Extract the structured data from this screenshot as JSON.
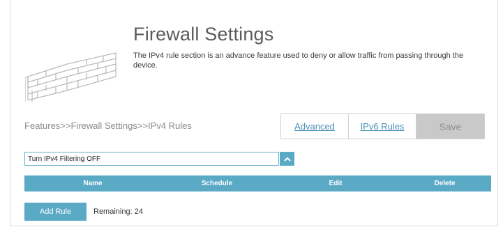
{
  "header": {
    "title": "Firewall Settings",
    "description": "The IPv4 rule section is an advance feature used to deny or allow traffic from passing through the device.",
    "icon": "brick-wall-icon"
  },
  "breadcrumb": "Features>>Firewall Settings>>IPv4 Rules",
  "actions": {
    "advanced_label": "Advanced",
    "ipv6_rules_label": "IPv6 Rules",
    "save_label": "Save"
  },
  "filter": {
    "selected": "Turn IPv4 Filtering OFF",
    "toggle_icon": "chevron-up-icon"
  },
  "table": {
    "columns": [
      "Name",
      "Schedule",
      "Edit",
      "Delete"
    ]
  },
  "footer": {
    "add_rule_label": "Add Rule",
    "remaining_text": "Remaining: 24"
  },
  "colors": {
    "accent": "#5aaac6",
    "link": "#4a90b8",
    "save_disabled_bg": "#c9c9c9"
  }
}
